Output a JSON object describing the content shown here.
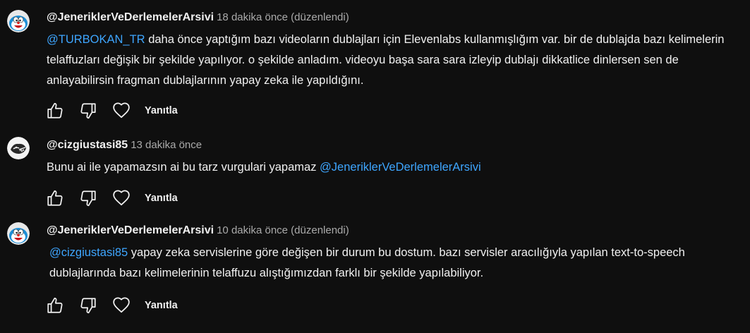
{
  "comments": [
    {
      "author": "@JeneriklerVeDerlemelerArsivi",
      "time": "18 dakika önce (düzenlendi)",
      "mention": "@TURBOKAN_TR",
      "text": "  daha önce yaptığım bazı videoların dublajları için Elevenlabs kullanmışlığım var. bir de dublajda bazı kelimelerin telaffuzları değişik bir şekilde yapılıyor. o şekilde anladım. videoyu başa sara sara izleyip dublajı dikkatlice dinlersen sen de anlayabilirsin fragman dublajlarının yapay zeka ile yapıldığını.",
      "reply_label": "Yanıtla",
      "avatar_icon": "doraemon-avatar-icon"
    },
    {
      "author": "@cizgiustasi85",
      "time": "13 dakika önce",
      "text": "Bunu ai ile yapamazsın ai bu tarz vurgulari yapamaz  ",
      "mention": "@JeneriklerVeDerlemelerArsivi",
      "reply_label": "Yanıtla",
      "avatar_icon": "dark-creature-avatar-icon"
    },
    {
      "author": "@JeneriklerVeDerlemelerArsivi",
      "time": "10 dakika önce (düzenlendi)",
      "mention": "@cizgiustasi85",
      "text": "  yapay zeka servislerine göre değişen bir durum bu dostum. bazı servisler aracılığıyla yapılan text-to-speech dublajlarında bazı kelimelerinin telaffuzu alıştığımızdan farklı bir şekilde yapılabiliyor.",
      "reply_label": "Yanıtla",
      "avatar_icon": "doraemon-avatar-icon"
    }
  ],
  "colors": {
    "background": "#0f0f0f",
    "text": "#f1f1f1",
    "secondary_text": "#aaaaaa",
    "mention": "#3ea6ff"
  },
  "icons": [
    "like-icon",
    "dislike-icon",
    "heart-icon"
  ]
}
